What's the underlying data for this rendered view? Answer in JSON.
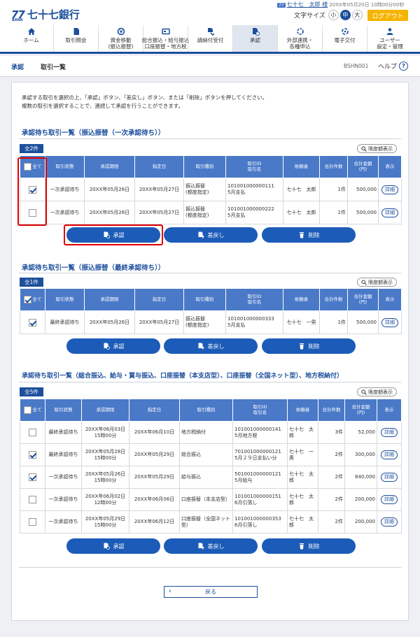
{
  "header": {
    "logo_mark": "77",
    "logo_bank": "BANK",
    "bank_name": "七十七銀行",
    "user_badge": "77",
    "user_name": "七十七　太郎 様",
    "login_time": "20XX年05月20日 10時00分00秒",
    "font_size_label": "文字サイズ",
    "font_sizes": [
      "小",
      "中",
      "大"
    ],
    "logout_label": "ログアウト"
  },
  "nav": [
    {
      "label": "ホーム",
      "icon": "home-icon"
    },
    {
      "label": "取引照会",
      "icon": "document-icon"
    },
    {
      "label": "資金移動\n(振込振替)",
      "icon": "money-transfer-icon"
    },
    {
      "label": "総合振込・給与振込\n口座振替・地方税",
      "icon": "card-icon"
    },
    {
      "label": "請納付受付",
      "icon": "payment-icon"
    },
    {
      "label": "承認",
      "icon": "approval-icon",
      "active": true
    },
    {
      "label": "外部連携・\n各種申込",
      "icon": "link-icon"
    },
    {
      "label": "電子交付",
      "icon": "delivery-icon"
    },
    {
      "label": "ユーザー\n設定・管理",
      "icon": "user-settings-icon"
    }
  ],
  "breadcrumb": {
    "section": "承認",
    "page": "取引一覧",
    "screen_id": "BSHN001",
    "help_label": "ヘルプ"
  },
  "intro": [
    "承認する取引を選択の上、「承認」ボタン、「差戻し」ボタン、または「削除」ボタンを押してください。",
    "複数の取引を選択することで、連続して承認を行うことができます。"
  ],
  "common": {
    "all_label": "全て",
    "limit_label": "限度額表示",
    "detail_label": "詳細",
    "approve_label": "承認",
    "return_label": "差戻し",
    "delete_label": "削除",
    "back_label": "戻る"
  },
  "columns": [
    "取引状態",
    "承認期限",
    "指定日",
    "取引種別",
    "取引ID\n取引名",
    "依頼者",
    "合計件数",
    "合計金額\n(円)",
    "表示"
  ],
  "sections": [
    {
      "title": "承認待ち取引一覧（振込振替（一次承認待ち））",
      "count": "全2件",
      "all_checked": false,
      "rows": [
        {
          "checked": true,
          "status": "一次承認待ち",
          "deadline": "20XX年05月26日",
          "date": "20XX年05月27日",
          "type": "振込振替\n(都度指定)",
          "id": "101001000000111\n5月支払",
          "requester": "七十七　太郎",
          "count": "1件",
          "amount": "500,000"
        },
        {
          "checked": false,
          "status": "一次承認待ち",
          "deadline": "20XX年05月26日",
          "date": "20XX年05月27日",
          "type": "振込振替\n(都度指定)",
          "id": "101001000000222\n5月支払",
          "requester": "七十七　太郎",
          "count": "1件",
          "amount": "500,000"
        }
      ]
    },
    {
      "title": "承認待ち取引一覧（振込振替（最終承認待ち））",
      "count": "全1件",
      "all_checked": true,
      "rows": [
        {
          "checked": true,
          "status": "最終承認待ち",
          "deadline": "20XX年05月26日",
          "date": "20XX年05月27日",
          "type": "振込振替\n(都度指定)",
          "id": "101001000000333\n5月支払",
          "requester": "七十七　一男",
          "count": "1件",
          "amount": "500,000"
        }
      ]
    },
    {
      "title": "承認待ち取引一覧（総合振込、給与・賞与振込、口座振替（本支店型）、口座振替（全国ネット型）、地方税納付）",
      "count": "全5件",
      "all_checked": false,
      "rows": [
        {
          "checked": false,
          "status": "最終承認待ち",
          "deadline": "20XX年06月03日\n15時00分",
          "date": "20XX年06月10日",
          "type": "地方税納付",
          "id": "101001000000141\n5月地方税",
          "requester": "七十七　太\n郎",
          "count": "3件",
          "amount": "52,000"
        },
        {
          "checked": true,
          "status": "最終承認待ち",
          "deadline": "20XX年05月28日\n15時00分",
          "date": "20XX年05月29日",
          "type": "総合振込",
          "id": "701001000000121\n5月２９日支払い分",
          "requester": "七十七　一\n男",
          "count": "2件",
          "amount": "300,000"
        },
        {
          "checked": true,
          "status": "一次承認待ち",
          "deadline": "20XX年05月26日\n15時00分",
          "date": "20XX年05月29日",
          "type": "給与振込",
          "id": "501001000000121\n5月給与",
          "requester": "七十七　太\n郎",
          "count": "2件",
          "amount": "840,000"
        },
        {
          "checked": false,
          "status": "一次承認待ち",
          "deadline": "20XX年06月02日\n12時00分",
          "date": "20XX年06月06日",
          "type": "口座振替（本支店型）",
          "id": "101001000000151\n6月引落し",
          "requester": "七十七　太\n郎",
          "count": "2件",
          "amount": "200,000"
        },
        {
          "checked": false,
          "status": "一次承認待ち",
          "deadline": "20XX年05月29日\n15時00分",
          "date": "20XX年06月12日",
          "type": "口座振替（全国ネット\n型）",
          "id": "101001000000353\n6月引落し",
          "requester": "七十七　太\n郎",
          "count": "2件",
          "amount": "200,000"
        }
      ]
    }
  ],
  "colors": {
    "brand": "#1c4f9c",
    "header_blue": "#4a79c8",
    "button_blue": "#1c5cb8",
    "logout": "#f5b400",
    "highlight": "#e00000"
  }
}
